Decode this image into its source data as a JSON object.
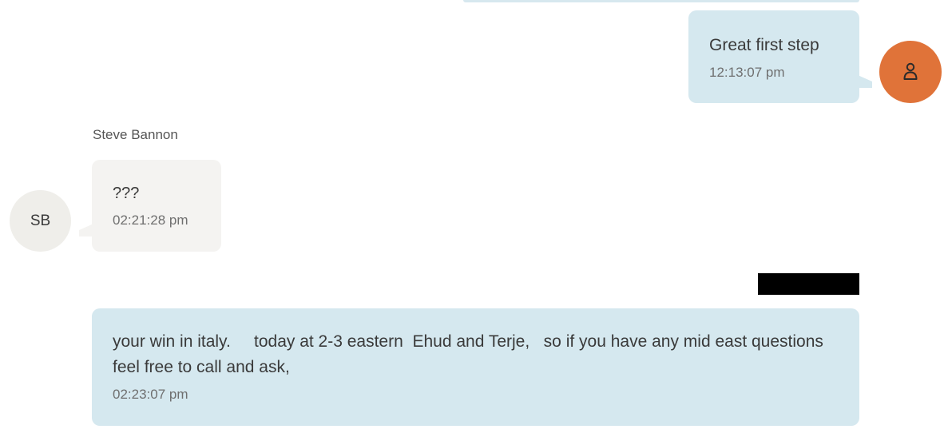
{
  "conversation": {
    "messages": [
      {
        "direction": "outgoing",
        "text": "Great first step",
        "time": "12:13:07 pm",
        "avatar_icon": "person-icon"
      },
      {
        "direction": "incoming",
        "sender": "Steve Bannon",
        "avatar_initials": "SB",
        "text": "???",
        "time": "02:21:28 pm"
      },
      {
        "direction": "outgoing",
        "sender_redacted": true,
        "text": "your win in italy.     today at 2-3 eastern  Ehud and Terje,   so if you have any mid east questions feel free to call and ask,",
        "time": "02:23:07 pm"
      }
    ]
  },
  "colors": {
    "outgoing_bubble": "#d5e8ef",
    "incoming_bubble": "#f4f3f1",
    "my_avatar": "#e07339",
    "other_avatar": "#efeeea",
    "redaction": "#000000"
  }
}
